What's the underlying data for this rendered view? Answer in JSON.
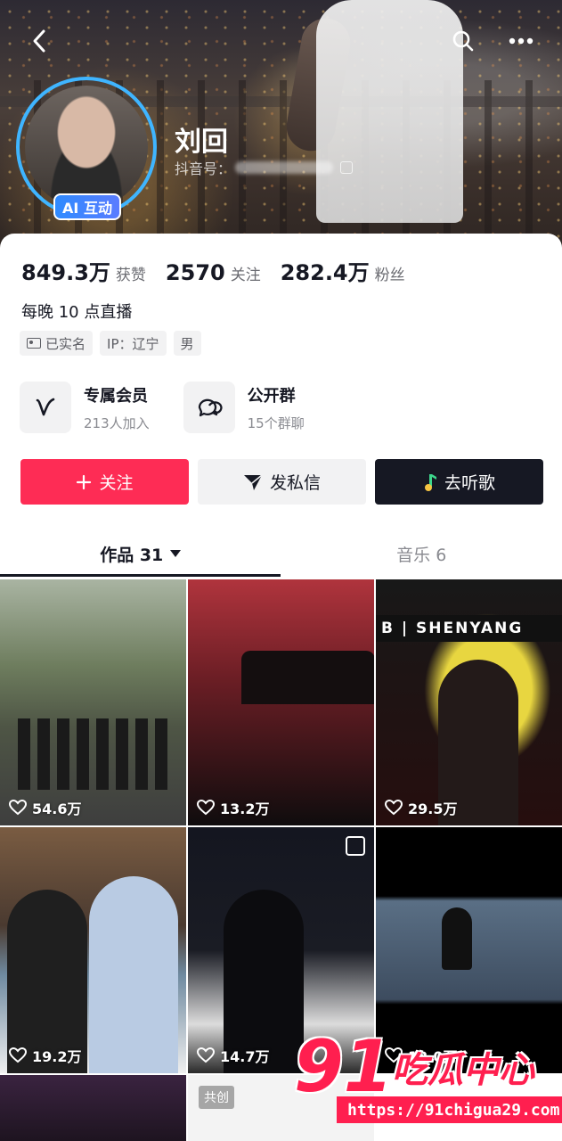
{
  "profile": {
    "name": "刘回",
    "id_label": "抖音号：",
    "ai_badge": "AI 互动",
    "bio": "每晚 10 点直播"
  },
  "stats": [
    {
      "value": "849.3万",
      "label": "获赞"
    },
    {
      "value": "2570",
      "label": "关注"
    },
    {
      "value": "282.4万",
      "label": "粉丝"
    }
  ],
  "tags": [
    {
      "label": "已实名",
      "icon": "id-card-icon"
    },
    {
      "label": "IP：辽宁"
    },
    {
      "label": "男"
    }
  ],
  "features": [
    {
      "title": "专属会员",
      "subtitle": "213人加入",
      "icon": "membership-v-icon"
    },
    {
      "title": "公开群",
      "subtitle": "15个群聊",
      "icon": "group-chat-icon"
    }
  ],
  "actions": {
    "follow": "关注",
    "message": "发私信",
    "listen": "去听歌"
  },
  "tabs": [
    {
      "label": "作品 31",
      "active": true
    },
    {
      "label": "音乐 6",
      "active": false
    }
  ],
  "videos": [
    {
      "likes": "54.6万"
    },
    {
      "likes": "13.2万"
    },
    {
      "likes": "29.5万",
      "overlay_text": "B | SHENYANG"
    },
    {
      "likes": "19.2万"
    },
    {
      "likes": "14.7万"
    },
    {
      "likes": "12.0万"
    },
    {
      "likes": ""
    },
    {
      "likes": "",
      "tag": "共创"
    },
    {
      "likes": ""
    }
  ],
  "watermark": {
    "number": "91",
    "text": "吃瓜中心",
    "url": "https://91chigua29.com"
  },
  "colors": {
    "accent": "#fe2c55",
    "avatar_ring": "#3fb5ff",
    "ai_badge": "#2f8bff",
    "watermark": "#ff1f4f"
  }
}
